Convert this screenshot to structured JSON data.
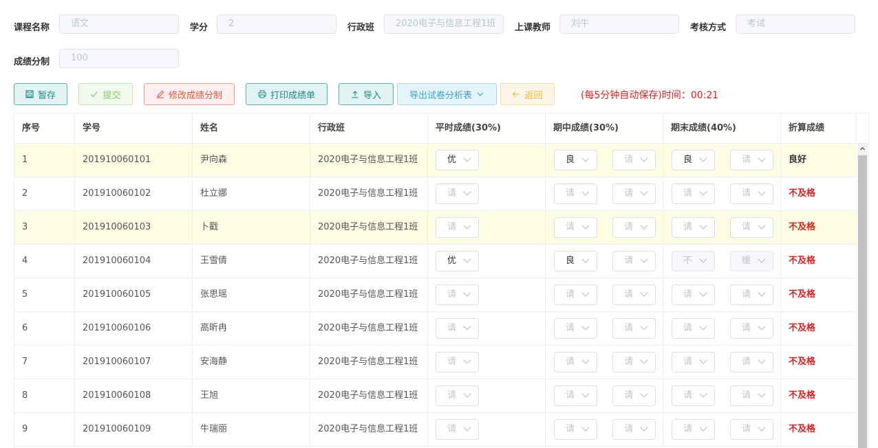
{
  "form": {
    "course_label": "课程名称",
    "course_value": "语文",
    "credit_label": "学分",
    "credit_value": "2",
    "class_label": "行政班",
    "class_value": "2020电子与信息工程1班",
    "teacher_label": "上课教师",
    "teacher_value": "刘牛",
    "exam_label": "考核方式",
    "exam_value": "考试",
    "split_label": "成绩分制",
    "split_value": "100"
  },
  "toolbar": {
    "save": "暂存",
    "submit": "提交",
    "modify": "修改成绩分制",
    "print": "打印成绩单",
    "import": "导入",
    "export": "导出试卷分析表",
    "back": "返回",
    "autosave": "(每5分钟自动保存)时间：00:21"
  },
  "table": {
    "headers": [
      "序号",
      "学号",
      "姓名",
      "行政班",
      "平时成绩(30%)",
      "期中成绩(30%)",
      "期末成绩(40%)",
      "折算成绩"
    ],
    "placeholder": "请",
    "rows": [
      {
        "no": "1",
        "id": "201910060101",
        "name": "尹向森",
        "cls": "2020电子与信息工程1班",
        "s1": "优",
        "s2": "良",
        "s3": "请",
        "s4": "良",
        "s5": "请",
        "result": "良好"
      },
      {
        "no": "2",
        "id": "201910060102",
        "name": "杜立娜",
        "cls": "2020电子与信息工程1班",
        "s1": "请",
        "s2": "请",
        "s3": "请",
        "s4": "请",
        "s5": "请",
        "result": "不及格"
      },
      {
        "no": "3",
        "id": "201910060103",
        "name": "卜戳",
        "cls": "2020电子与信息工程1班",
        "s1": "请",
        "s2": "请",
        "s3": "请",
        "s4": "请",
        "s5": "请",
        "result": "不及格"
      },
      {
        "no": "4",
        "id": "201910060104",
        "name": "王雪倩",
        "cls": "2020电子与信息工程1班",
        "s1": "优",
        "s2": "良",
        "s3": "请",
        "s4": "不",
        "s5": "缓",
        "result": "不及格"
      },
      {
        "no": "5",
        "id": "201910060105",
        "name": "张思瑶",
        "cls": "2020电子与信息工程1班",
        "s1": "请",
        "s2": "请",
        "s3": "请",
        "s4": "请",
        "s5": "请",
        "result": "不及格"
      },
      {
        "no": "6",
        "id": "201910060106",
        "name": "高昕冉",
        "cls": "2020电子与信息工程1班",
        "s1": "请",
        "s2": "请",
        "s3": "请",
        "s4": "请",
        "s5": "请",
        "result": "不及格"
      },
      {
        "no": "7",
        "id": "201910060107",
        "name": "安海静",
        "cls": "2020电子与信息工程1班",
        "s1": "请",
        "s2": "请",
        "s3": "请",
        "s4": "请",
        "s5": "请",
        "result": "不及格"
      },
      {
        "no": "8",
        "id": "201910060108",
        "name": "王旭",
        "cls": "2020电子与信息工程1班",
        "s1": "请",
        "s2": "请",
        "s3": "请",
        "s4": "请",
        "s5": "请",
        "result": "不及格"
      },
      {
        "no": "9",
        "id": "201910060109",
        "name": "牛瑞丽",
        "cls": "2020电子与信息工程1班",
        "s1": "请",
        "s2": "请",
        "s3": "请",
        "s4": "请",
        "s5": "请",
        "result": "不及格"
      }
    ]
  },
  "colors": {
    "accent": "#1f8c86",
    "fail": "#e02020",
    "highlight_row": "#fdfde4"
  }
}
